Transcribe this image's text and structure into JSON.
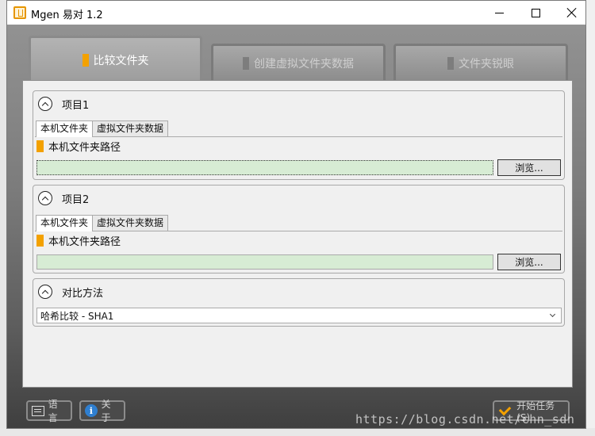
{
  "window": {
    "title": "Mgen 易对 1.2",
    "controls": {
      "minimize": "minimize",
      "maximize": "maximize",
      "close": "close"
    }
  },
  "top_tabs": [
    {
      "label": "比较文件夹",
      "active": true
    },
    {
      "label": "创建虚拟文件夹数据",
      "active": false
    },
    {
      "label": "文件夹锐眼",
      "active": false
    }
  ],
  "groups": [
    {
      "title": "项目1",
      "tabs": [
        "本机文件夹",
        "虚拟文件夹数据"
      ],
      "active_tab": 0,
      "path_label": "本机文件夹路径",
      "path_value": "",
      "browse_label": "浏览..."
    },
    {
      "title": "项目2",
      "tabs": [
        "本机文件夹",
        "虚拟文件夹数据"
      ],
      "active_tab": 0,
      "path_label": "本机文件夹路径",
      "path_value": "",
      "browse_label": "浏览..."
    }
  ],
  "compare": {
    "title": "对比方法",
    "selected": "哈希比较 - SHA1"
  },
  "footer": {
    "language_label": "语言",
    "about_label": "关于",
    "start_label": "开始任务(S)"
  },
  "watermark": "https://blog.csdn.net/chn_sdn",
  "colors": {
    "accent": "#f3a100",
    "path_input_bg": "#d7ecd4",
    "info_icon": "#2f7fd0"
  }
}
